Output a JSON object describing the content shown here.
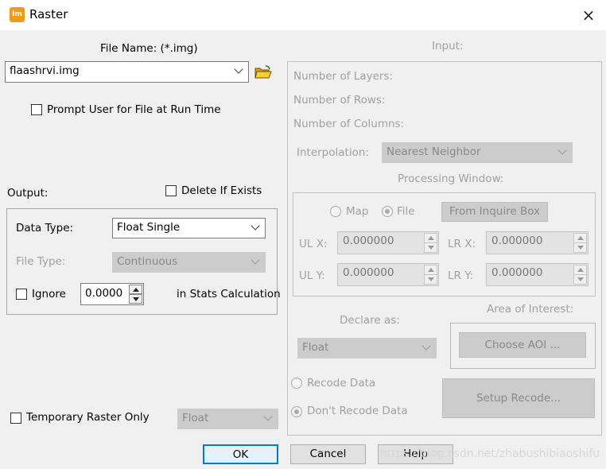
{
  "window": {
    "title": "Raster",
    "app_icon_text": "Im",
    "close_icon": "×"
  },
  "left": {
    "file_name_label": "File Name: (*.img)",
    "file_name_value": "flaashrvi.img",
    "prompt_label": "Prompt User for File at Run Time",
    "output_label": "Output:",
    "delete_if_exists_label": "Delete If Exists",
    "data_type_label": "Data Type:",
    "data_type_value": "Float Single",
    "file_type_label": "File Type:",
    "file_type_value": "Continuous",
    "ignore_label": "Ignore",
    "ignore_value": "0.0000",
    "stats_label": "in Stats Calculation",
    "temp_raster_label": "Temporary Raster Only",
    "temp_raster_value": "Float"
  },
  "right": {
    "input_label": "Input:",
    "layers_label": "Number of Layers:",
    "rows_label": "Number of Rows:",
    "cols_label": "Number of Columns:",
    "interp_label": "Interpolation:",
    "interp_value": "Nearest Neighbor",
    "processing_window_label": "Processing Window:",
    "map_label": "Map",
    "file_label": "File",
    "inquire_button": "From Inquire Box",
    "ulx_label": "UL X:",
    "ulx_value": "0.000000",
    "lrx_label": "LR X:",
    "lrx_value": "0.000000",
    "uly_label": "UL Y:",
    "uly_value": "0.000000",
    "lry_label": "LR Y:",
    "lry_value": "0.000000",
    "declare_label": "Declare as:",
    "declare_value": "Float",
    "aoi_label": "Area of Interest:",
    "aoi_button": "Choose AOI ...",
    "recode_label": "Recode Data",
    "dont_recode_label": "Don't Recode Data",
    "setup_recode_button": "Setup Recode..."
  },
  "footer": {
    "ok": "OK",
    "cancel": "Cancel",
    "help": "Help",
    "watermark": "https://blog.csdn.net/zhabushibiaoshifu"
  },
  "colors": {
    "app_icon": "#f39a1e",
    "disabled_text": "#a0a0a0",
    "ok_border": "#0078d7"
  }
}
